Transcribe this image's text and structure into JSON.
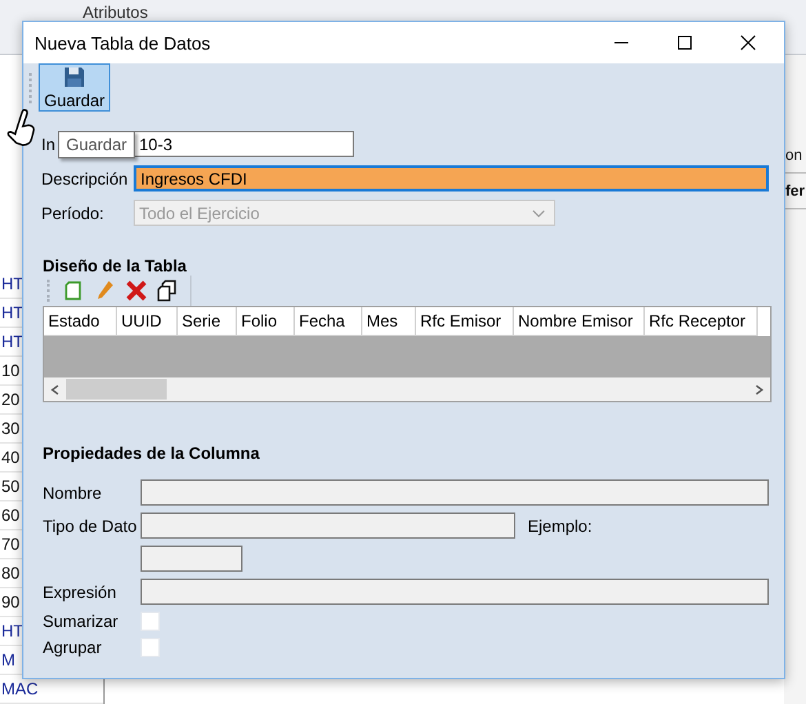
{
  "background": {
    "header_label": "Atributos",
    "left_column": [
      {
        "text": "HT",
        "kind": "link"
      },
      {
        "text": "HT",
        "kind": "link"
      },
      {
        "text": "HT",
        "kind": "link"
      },
      {
        "text": "10",
        "kind": "plain"
      },
      {
        "text": "20",
        "kind": "plain"
      },
      {
        "text": "30",
        "kind": "plain"
      },
      {
        "text": "40",
        "kind": "plain"
      },
      {
        "text": "50",
        "kind": "plain"
      },
      {
        "text": "60",
        "kind": "plain"
      },
      {
        "text": "70",
        "kind": "plain"
      },
      {
        "text": "80",
        "kind": "plain"
      },
      {
        "text": "90",
        "kind": "plain"
      },
      {
        "text": "HT",
        "kind": "link"
      },
      {
        "text": "M",
        "kind": "link"
      },
      {
        "text": "MAC",
        "kind": "link"
      }
    ],
    "right_column": [
      {
        "text": "on",
        "kind": "plain"
      },
      {
        "text": "fer",
        "kind": "bold"
      }
    ]
  },
  "dialog": {
    "title": "Nueva Tabla de Datos",
    "toolbar": [
      {
        "label": "Guardar",
        "hovered": true
      }
    ],
    "tooltip": "Guardar",
    "fields": [
      {
        "label": "In",
        "value": "10-3",
        "kind": "text"
      },
      {
        "label": "Descripción",
        "value": "Ingresos CFDI",
        "kind": "highlighted"
      },
      {
        "label": "Período:",
        "value": "Todo el Ejercicio",
        "kind": "combo",
        "disabled": true
      }
    ],
    "table_design": {
      "title": "Diseño de la Tabla",
      "columns": [
        "Estado",
        "UUID",
        "Serie",
        "Folio",
        "Fecha",
        "Mes",
        "Rfc Emisor",
        "Nombre Emisor",
        "Rfc Receptor"
      ]
    },
    "column_properties": {
      "title": "Propiedades de la Columna",
      "name_label": "Nombre",
      "type_label": "Tipo de Dato",
      "example_label": "Ejemplo:",
      "expression_label": "Expresión",
      "checkboxes": [
        {
          "label": "Sumarizar",
          "checked": false
        },
        {
          "label": "Agrupar",
          "checked": false
        }
      ]
    }
  }
}
